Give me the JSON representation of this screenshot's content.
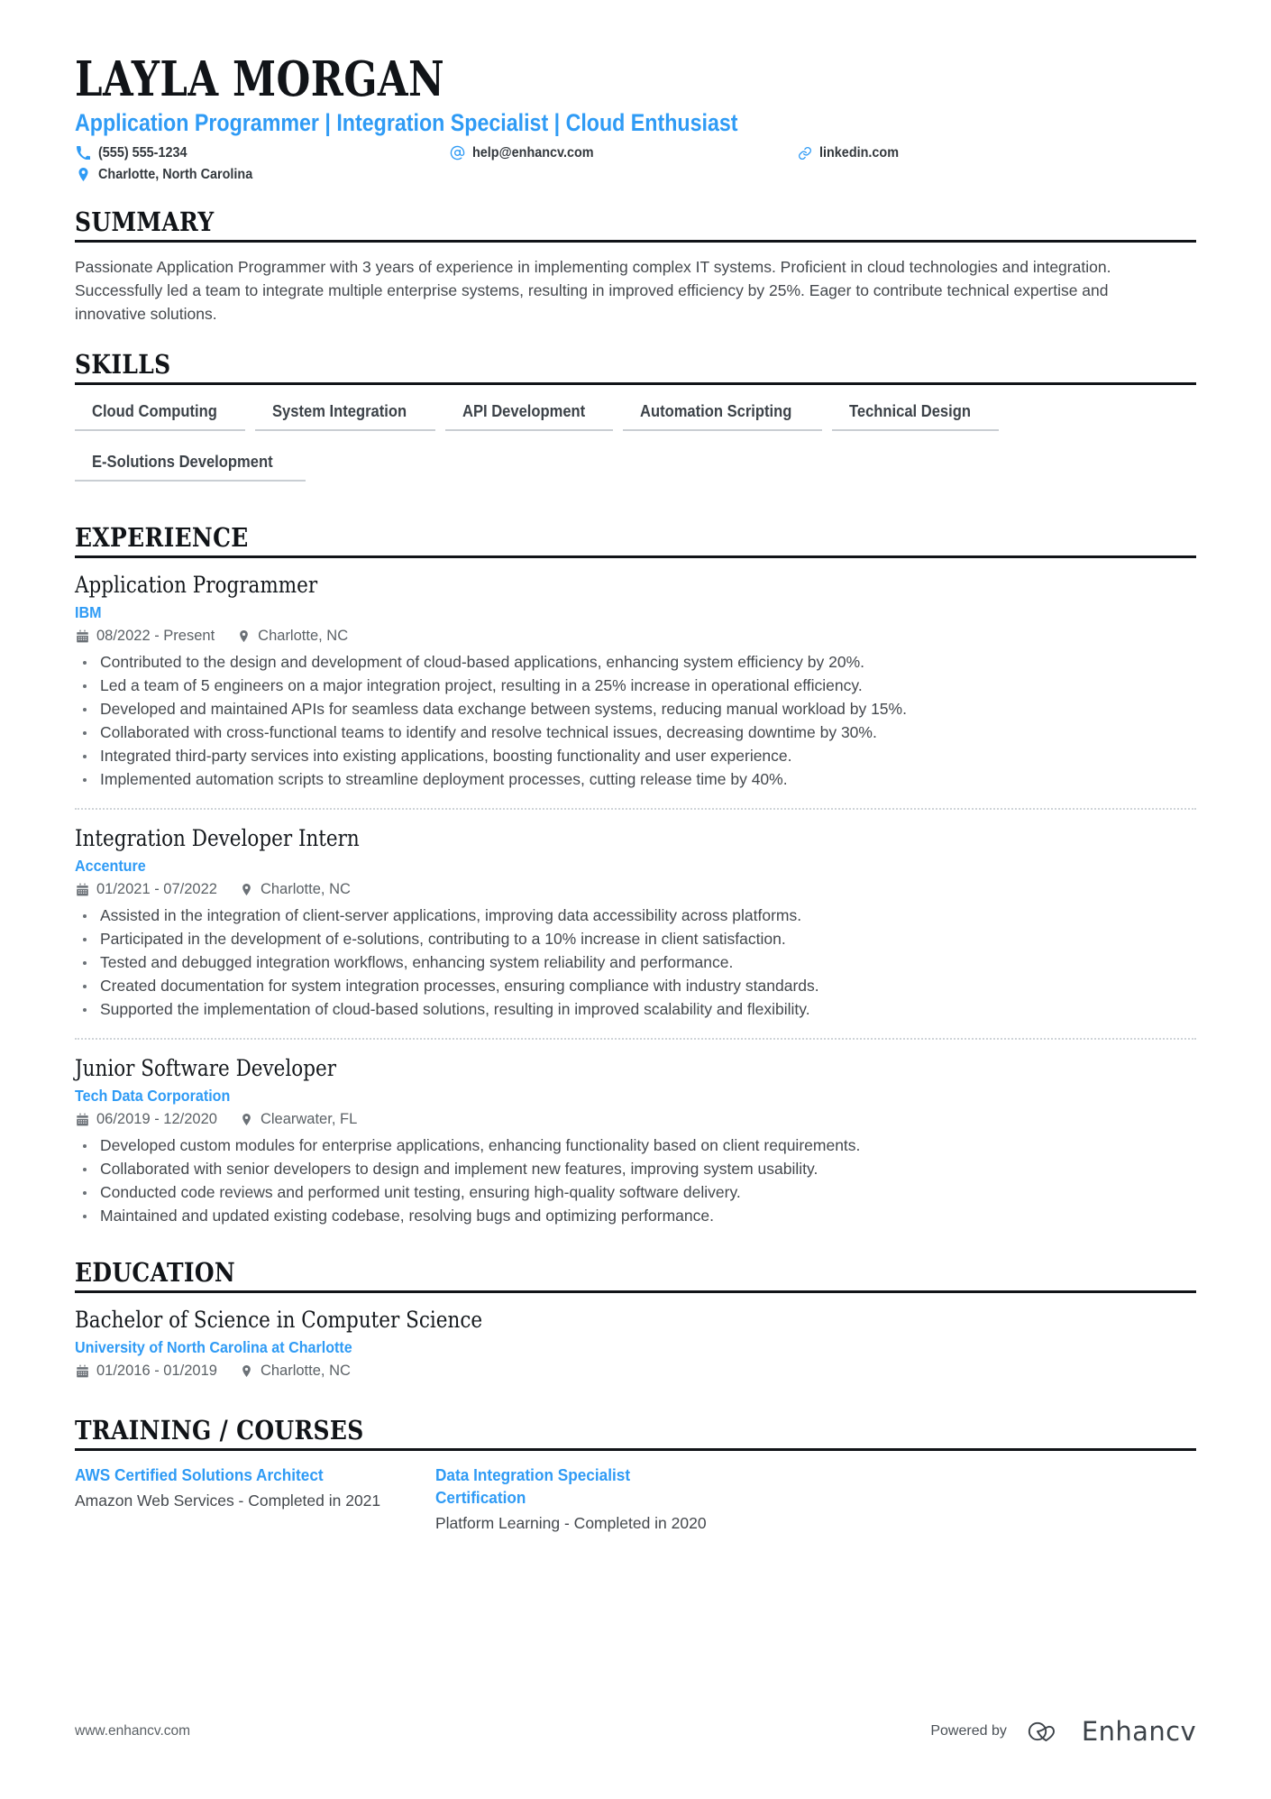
{
  "header": {
    "name": "LAYLA MORGAN",
    "headline": "Application Programmer | Integration Specialist | Cloud Enthusiast",
    "contacts": {
      "phone": "(555) 555-1234",
      "email": "help@enhancv.com",
      "linkedin": "linkedin.com",
      "location": "Charlotte, North Carolina"
    }
  },
  "accent_color": "#2f9bf5",
  "sections": {
    "summary": {
      "title": "SUMMARY",
      "text": "Passionate Application Programmer with 3 years of experience in implementing complex IT systems. Proficient in cloud technologies and integration. Successfully led a team to integrate multiple enterprise systems, resulting in improved efficiency by 25%. Eager to contribute technical expertise and innovative solutions."
    },
    "skills": {
      "title": "SKILLS",
      "items": [
        "Cloud Computing",
        "System Integration",
        "API Development",
        "Automation Scripting",
        "Technical Design",
        "E-Solutions Development"
      ]
    },
    "experience": {
      "title": "EXPERIENCE",
      "entries": [
        {
          "title": "Application Programmer",
          "org": "IBM",
          "dates": "08/2022 - Present",
          "location": "Charlotte, NC",
          "bullets": [
            "Contributed to the design and development of cloud-based applications, enhancing system efficiency by 20%.",
            "Led a team of 5 engineers on a major integration project, resulting in a 25% increase in operational efficiency.",
            "Developed and maintained APIs for seamless data exchange between systems, reducing manual workload by 15%.",
            "Collaborated with cross-functional teams to identify and resolve technical issues, decreasing downtime by 30%.",
            "Integrated third-party services into existing applications, boosting functionality and user experience.",
            "Implemented automation scripts to streamline deployment processes, cutting release time by 40%."
          ]
        },
        {
          "title": "Integration Developer Intern",
          "org": "Accenture",
          "dates": "01/2021 - 07/2022",
          "location": "Charlotte, NC",
          "bullets": [
            "Assisted in the integration of client-server applications, improving data accessibility across platforms.",
            "Participated in the development of e-solutions, contributing to a 10% increase in client satisfaction.",
            "Tested and debugged integration workflows, enhancing system reliability and performance.",
            "Created documentation for system integration processes, ensuring compliance with industry standards.",
            "Supported the implementation of cloud-based solutions, resulting in improved scalability and flexibility."
          ]
        },
        {
          "title": "Junior Software Developer",
          "org": "Tech Data Corporation",
          "dates": "06/2019 - 12/2020",
          "location": "Clearwater, FL",
          "bullets": [
            "Developed custom modules for enterprise applications, enhancing functionality based on client requirements.",
            "Collaborated with senior developers to design and implement new features, improving system usability.",
            "Conducted code reviews and performed unit testing, ensuring high-quality software delivery.",
            "Maintained and updated existing codebase, resolving bugs and optimizing performance."
          ]
        }
      ]
    },
    "education": {
      "title": "EDUCATION",
      "entries": [
        {
          "title": "Bachelor of Science in Computer Science",
          "org": "University of North Carolina at Charlotte",
          "dates": "01/2016 - 01/2019",
          "location": "Charlotte, NC"
        }
      ]
    },
    "training": {
      "title": "TRAINING / COURSES",
      "items": [
        {
          "title": "AWS Certified Solutions Architect",
          "description": "Amazon Web Services - Completed in 2021"
        },
        {
          "title": "Data Integration Specialist Certification",
          "description": "Platform Learning - Completed in 2020"
        }
      ]
    }
  },
  "footer": {
    "url": "www.enhancv.com",
    "powered_by": "Powered by",
    "brand": "Enhancv"
  }
}
